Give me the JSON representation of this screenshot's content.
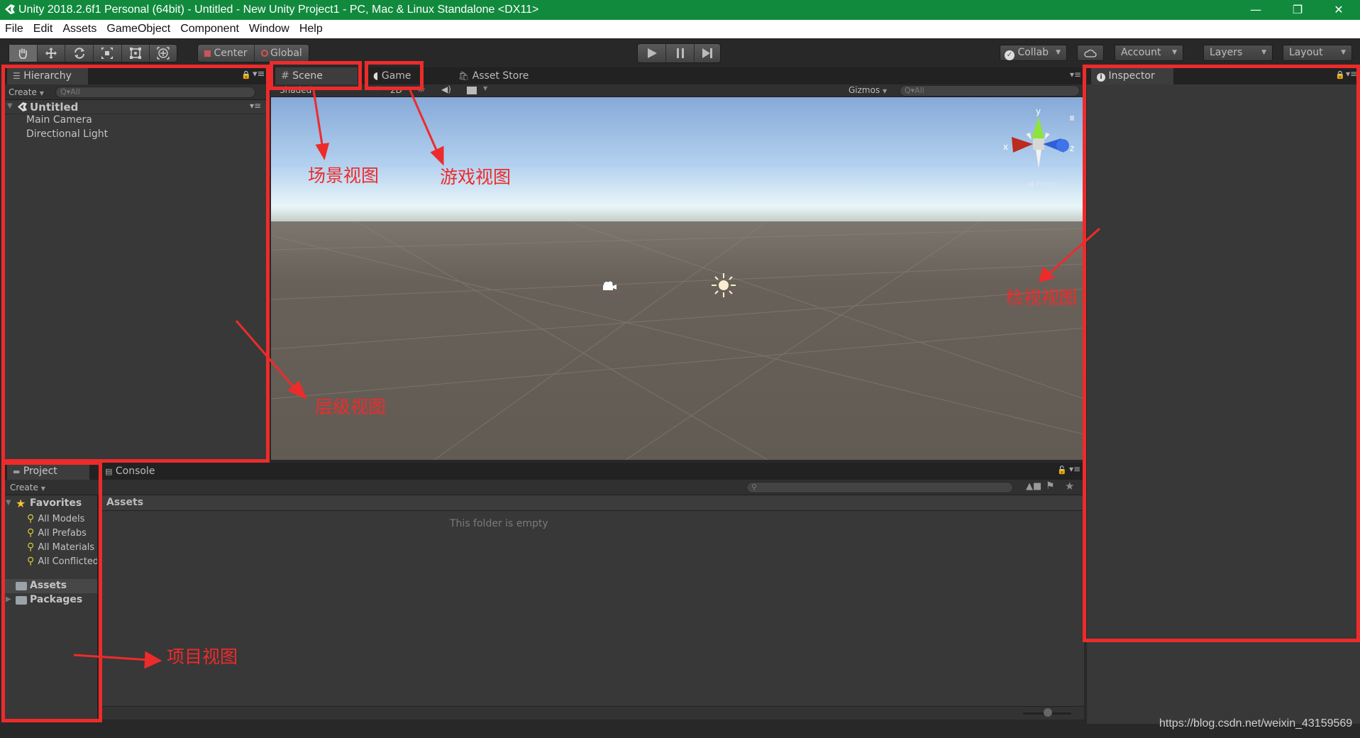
{
  "window": {
    "title": "Unity 2018.2.6f1 Personal (64bit) - Untitled - New Unity Project1 - PC, Mac & Linux Standalone <DX11>",
    "minimize_glyph": "—",
    "restore_glyph": "❐",
    "close_glyph": "✕"
  },
  "menu": [
    "File",
    "Edit",
    "Assets",
    "GameObject",
    "Component",
    "Window",
    "Help"
  ],
  "toolbar": {
    "tools": [
      "hand-tool",
      "move-tool",
      "rotate-tool",
      "scale-tool",
      "rect-tool",
      "transform-tool"
    ],
    "pivot_label": "Center",
    "space_label": "Global",
    "play_controls": [
      "play",
      "pause",
      "step"
    ],
    "collab_label": "Collab",
    "account_label": "Account",
    "layers_label": "Layers",
    "layout_label": "Layout"
  },
  "hierarchy": {
    "tab_label": "Hierarchy",
    "create_label": "Create",
    "search_placeholder": "Q▾All",
    "scene_name": "Untitled",
    "items": [
      "Main Camera",
      "Directional Light"
    ]
  },
  "scene_view": {
    "tabs": [
      "Scene",
      "Game",
      "Asset Store"
    ],
    "shading_mode": "Shaded",
    "mode_2d": "2D",
    "gizmos_label": "Gizmos",
    "search_placeholder": "Q▾All",
    "axis_labels": {
      "x": "x",
      "y": "y",
      "z": "z"
    },
    "persp_label": "Persp"
  },
  "inspector": {
    "tab_label": "Inspector"
  },
  "project": {
    "tabs": [
      "Project",
      "Console"
    ],
    "create_label": "Create",
    "favorites_label": "Favorites",
    "favorites": [
      "All Models",
      "All Prefabs",
      "All Materials",
      "All Conflicted"
    ],
    "roots": [
      "Assets",
      "Packages"
    ],
    "breadcrumb": "Assets",
    "empty_message": "This folder is empty",
    "zoom_slider_value": 0.5
  },
  "annotations": {
    "scene_view": "场景视图",
    "game_view": "游戏视图",
    "inspector_view": "检视视图",
    "hierarchy_view": "层级视图",
    "project_view": "项目视图",
    "color": "#ee2b2b"
  },
  "watermark": "https://blog.csdn.net/weixin_43159569"
}
